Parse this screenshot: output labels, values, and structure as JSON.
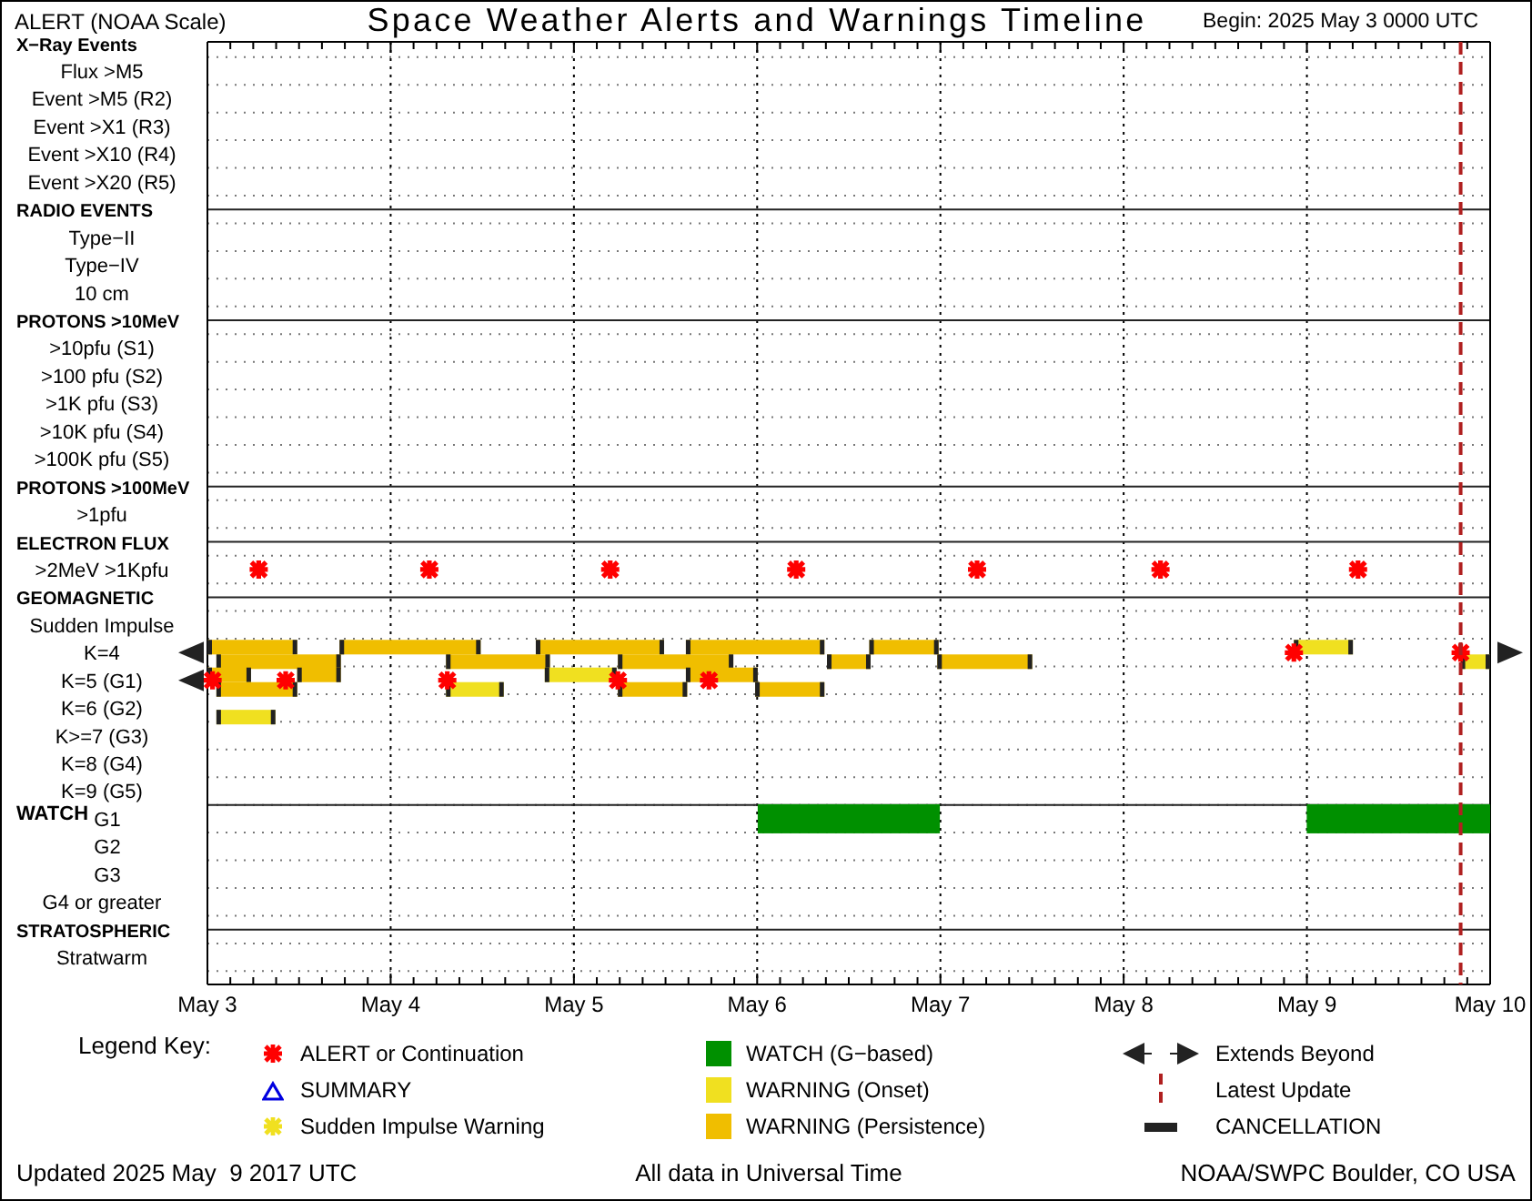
{
  "header": {
    "scale_label": "ALERT (NOAA Scale)",
    "title": "Space Weather Alerts and Warnings Timeline",
    "begin": "Begin: 2025 May 3 0000 UTC"
  },
  "rows": [
    {
      "label": "X−Ray Events",
      "kind": "heading"
    },
    {
      "label": "Flux >M5",
      "kind": "item"
    },
    {
      "label": "Event >M5 (R2)",
      "kind": "item"
    },
    {
      "label": "Event >X1 (R3)",
      "kind": "item"
    },
    {
      "label": "Event >X10 (R4)",
      "kind": "item"
    },
    {
      "label": "Event >X20 (R5)",
      "kind": "item"
    },
    {
      "label": "RADIO EVENTS",
      "kind": "heading"
    },
    {
      "label": "Type−II",
      "kind": "item"
    },
    {
      "label": "Type−IV",
      "kind": "item"
    },
    {
      "label": "10 cm",
      "kind": "item"
    },
    {
      "label": "PROTONS >10MeV",
      "kind": "heading"
    },
    {
      "label": ">10pfu (S1)",
      "kind": "item"
    },
    {
      "label": ">100 pfu (S2)",
      "kind": "item"
    },
    {
      "label": ">1K pfu (S3)",
      "kind": "item"
    },
    {
      "label": ">10K pfu (S4)",
      "kind": "item"
    },
    {
      "label": ">100K pfu (S5)",
      "kind": "item"
    },
    {
      "label": "PROTONS >100MeV",
      "kind": "heading"
    },
    {
      "label": ">1pfu",
      "kind": "item"
    },
    {
      "label": "ELECTRON FLUX",
      "kind": "heading"
    },
    {
      "label": ">2MeV >1Kpfu",
      "kind": "item"
    },
    {
      "label": "GEOMAGNETIC",
      "kind": "heading"
    },
    {
      "label": "Sudden Impulse",
      "kind": "item"
    },
    {
      "label": "K=4",
      "kind": "item"
    },
    {
      "label": "K=5 (G1)",
      "kind": "item"
    },
    {
      "label": "K=6 (G2)",
      "kind": "item"
    },
    {
      "label": "K>=7 (G3)",
      "kind": "item"
    },
    {
      "label": "K=8 (G4)",
      "kind": "item"
    },
    {
      "label": "K=9 (G5)",
      "kind": "item"
    },
    {
      "label": "WATCH",
      "kind": "section"
    },
    {
      "label": "G1",
      "kind": "item"
    },
    {
      "label": "G2",
      "kind": "item"
    },
    {
      "label": "G3",
      "kind": "item"
    },
    {
      "label": "G4 or greater",
      "kind": "item"
    },
    {
      "label": "STRATOSPHERIC",
      "kind": "heading"
    },
    {
      "label": "Stratwarm",
      "kind": "item"
    }
  ],
  "axis_labels": [
    "May 3",
    "May 4",
    "May 5",
    "May 6",
    "May 7",
    "May 8",
    "May 9",
    "May 10"
  ],
  "legend": {
    "title": "Legend Key:",
    "items": [
      {
        "kind": "alert",
        "label": "ALERT or Continuation"
      },
      {
        "kind": "watch",
        "label": "WATCH (G−based)"
      },
      {
        "kind": "extends",
        "label": "Extends Beyond"
      },
      {
        "kind": "summary",
        "label": "SUMMARY"
      },
      {
        "kind": "onset",
        "label": "WARNING (Onset)"
      },
      {
        "kind": "latest",
        "label": "Latest Update"
      },
      {
        "kind": "sudden",
        "label": "Sudden Impulse Warning"
      },
      {
        "kind": "persistence",
        "label": "WARNING (Persistence)"
      },
      {
        "kind": "cancellation",
        "label": "CANCELLATION"
      }
    ]
  },
  "footer": {
    "updated": "Updated 2025 May  9 2017 UTC",
    "note": "All data in Universal Time",
    "source": "NOAA/SWPC Boulder, CO USA"
  }
}
